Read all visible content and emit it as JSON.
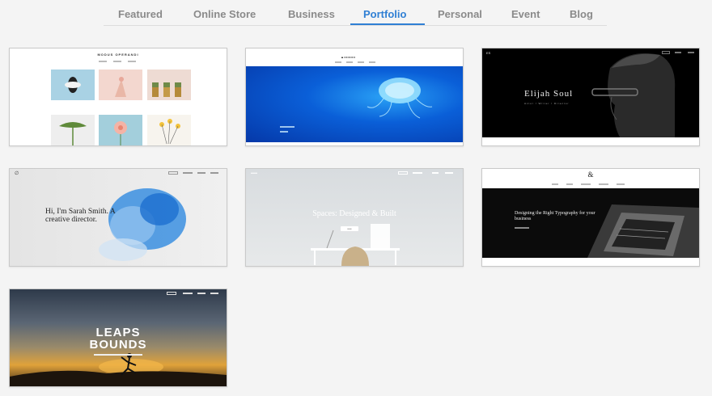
{
  "tabs": [
    {
      "label": "Featured",
      "active": false
    },
    {
      "label": "Online Store",
      "active": false
    },
    {
      "label": "Business",
      "active": false
    },
    {
      "label": "Portfolio",
      "active": true
    },
    {
      "label": "Personal",
      "active": false
    },
    {
      "label": "Event",
      "active": false
    },
    {
      "label": "Blog",
      "active": false
    }
  ],
  "accent_color": "#2f7fd4",
  "templates": [
    {
      "name": "modus-operandi",
      "logo": "MODUS OPERANDI"
    },
    {
      "name": "jellyfish",
      "logo": "▴ ••••••••••"
    },
    {
      "name": "elijah-soul",
      "logo": "ES",
      "title": "Elijah Soul",
      "subtitle": "Actor / Writer / Director"
    },
    {
      "name": "sarah-smith",
      "logo": "∅",
      "headline": "Hi, I'm Sarah Smith. A creative director."
    },
    {
      "name": "spaces",
      "title": "Spaces: Designed & Built",
      "button": "•••••"
    },
    {
      "name": "typography",
      "logo": "&",
      "title": "Designing the Right Typography for your business"
    },
    {
      "name": "leaps-bounds",
      "title_line1": "LEAPS",
      "title_line2": "BOUNDS"
    }
  ]
}
